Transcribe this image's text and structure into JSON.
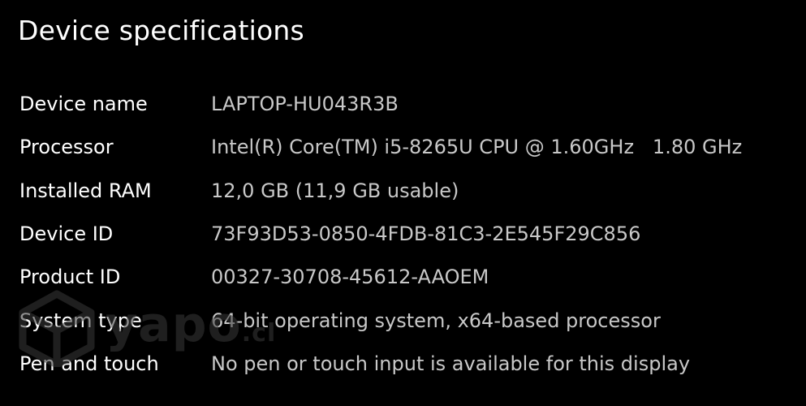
{
  "section": {
    "title": "Device specifications"
  },
  "specs": [
    {
      "label": "Device name",
      "value": "LAPTOP-HU043R3B"
    },
    {
      "label": "Processor",
      "value": "Intel(R) Core(TM) i5-8265U CPU @ 1.60GHz   1.80 GHz"
    },
    {
      "label": "Installed RAM",
      "value": "12,0 GB (11,9 GB usable)"
    },
    {
      "label": "Device ID",
      "value": "73F93D53-0850-4FDB-81C3-2E545F29C856"
    },
    {
      "label": "Product ID",
      "value": "00327-30708-45612-AAOEM"
    },
    {
      "label": "System type",
      "value": "64-bit operating system, x64-based processor"
    },
    {
      "label": "Pen and touch",
      "value": "No pen or touch input is available for this display"
    }
  ],
  "watermark": {
    "text": "yapo",
    "suffix": ".cl"
  },
  "colors": {
    "background": "#000000",
    "label": "#ffffff",
    "value": "#c8c8c8"
  }
}
